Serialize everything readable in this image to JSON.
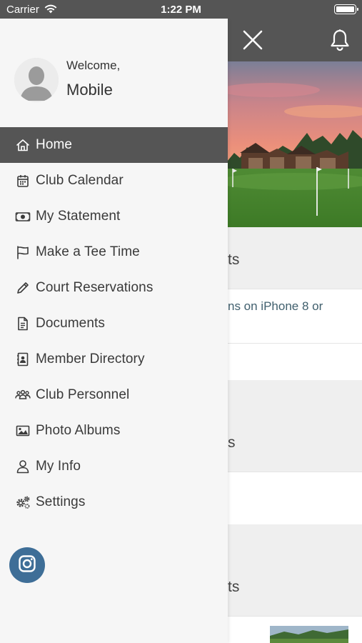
{
  "status_bar": {
    "carrier": "Carrier",
    "time": "1:22 PM",
    "wifi_icon": "wifi-icon",
    "battery_icon": "battery-icon",
    "battery_level": 1.0
  },
  "drawer": {
    "welcome_text": "Welcome,",
    "username": "Mobile",
    "avatar_icon": "user-silhouette-icon",
    "menu": [
      {
        "label": "Home",
        "icon": "home-icon",
        "active": true
      },
      {
        "label": "Club Calendar",
        "icon": "calendar-icon",
        "active": false
      },
      {
        "label": "My Statement",
        "icon": "money-icon",
        "active": false
      },
      {
        "label": "Make a Tee Time",
        "icon": "flag-icon",
        "active": false
      },
      {
        "label": "Court Reservations",
        "icon": "pencil-icon",
        "active": false
      },
      {
        "label": "Documents",
        "icon": "document-icon",
        "active": false
      },
      {
        "label": "Member Directory",
        "icon": "address-book-icon",
        "active": false
      },
      {
        "label": "Club Personnel",
        "icon": "people-icon",
        "active": false
      },
      {
        "label": "Photo Albums",
        "icon": "image-icon",
        "active": false
      },
      {
        "label": "My Info",
        "icon": "person-icon",
        "active": false
      },
      {
        "label": "Settings",
        "icon": "gears-icon",
        "active": false
      }
    ],
    "social_icon": "instagram-icon"
  },
  "background_app": {
    "close_icon": "close-icon",
    "bell_icon": "bell-icon",
    "section_1_title_fragment": "ts",
    "row_1_text_fragment": "ns on iPhone 8 or",
    "section_2_title_fragment": "s",
    "section_3_title_fragment": "ts"
  },
  "colors": {
    "header_gray": "#555555",
    "drawer_bg": "#f6f6f6",
    "active_item_bg": "#555555",
    "instagram_button": "#3e6e97",
    "link_text": "#41606e"
  }
}
